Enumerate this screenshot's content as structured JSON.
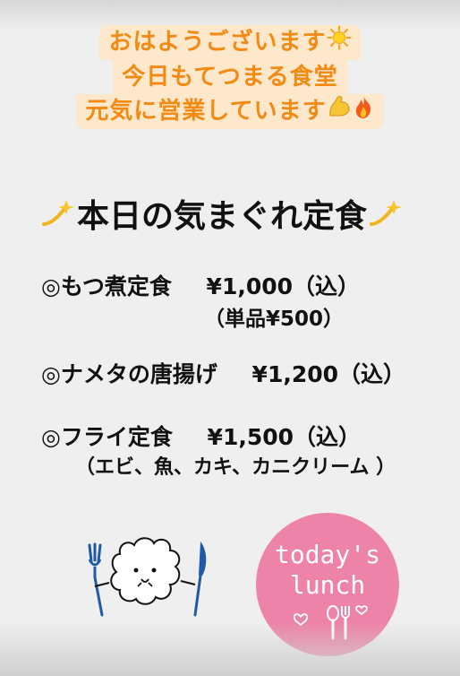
{
  "greeting": {
    "line1": "おはようございます",
    "line2": "今日もてつまる食堂",
    "line3": "元気に営業しています",
    "icons": [
      "sun-icon",
      "flexed-biceps-icon",
      "fire-icon"
    ],
    "accent_color": "#f28a14",
    "highlight_color": "#fde8cc"
  },
  "menu": {
    "title": "本日の気まぐれ定食",
    "title_icon": "dizzy-sparkle-icon",
    "items": [
      {
        "name": "◎もつ煮定食",
        "price": "¥1,000（込）",
        "note": "（単品¥500）"
      },
      {
        "name": "◎ナメタの唐揚げ",
        "price": "¥1,200（込）"
      },
      {
        "name": "◎フライ定食",
        "price": "¥1,500（込）",
        "note": "（エビ、魚、カキ、カニクリーム ）"
      }
    ]
  },
  "badge": {
    "line1": "today's",
    "line2": "lunch",
    "color": "#ee83a9"
  },
  "mascot": {
    "icon": "sheep-with-fork-and-knife-icon"
  }
}
